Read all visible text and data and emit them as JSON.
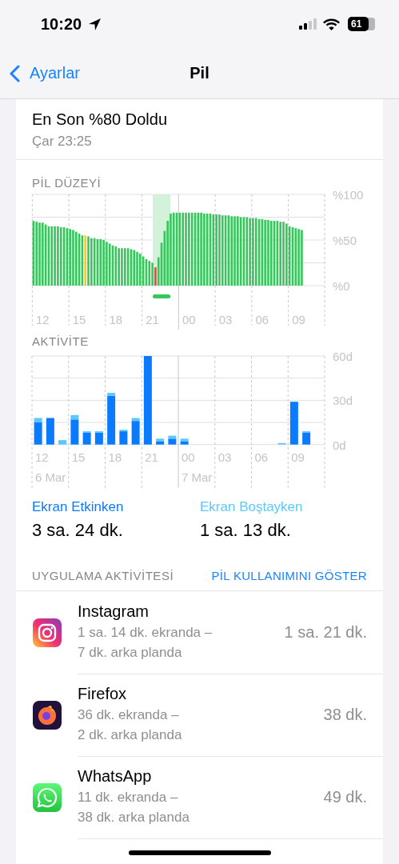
{
  "status_bar": {
    "time": "10:20",
    "battery": "61"
  },
  "nav": {
    "back": "Ayarlar",
    "title": "Pil"
  },
  "last_charge": {
    "title": "En Son %80 Doldu",
    "time": "Çar 23:25"
  },
  "battery_level": {
    "label": "PİL DÜZEYİ",
    "chart_data": {
      "type": "bar",
      "grid": true,
      "ylim": [
        0,
        100
      ],
      "categories": [
        null,
        null,
        null,
        "12",
        null,
        null,
        null,
        null,
        null,
        null,
        null,
        null,
        null,
        null,
        null,
        "15",
        null,
        null,
        null,
        null,
        null,
        null,
        null,
        null,
        null,
        null,
        null,
        "18",
        null,
        null,
        null,
        null,
        null,
        null,
        null,
        null,
        null,
        null,
        null,
        "21",
        null,
        null,
        null,
        null,
        null,
        null,
        null,
        null,
        null,
        null,
        null,
        "00",
        null,
        null,
        null,
        null,
        null,
        null,
        null,
        null,
        null,
        null,
        null,
        "03",
        null,
        null,
        null,
        null,
        null,
        null,
        null,
        null,
        null,
        null,
        null,
        "06",
        null,
        null,
        null,
        null,
        null,
        null,
        null,
        null,
        null,
        null,
        null,
        "09",
        null,
        null,
        null,
        null,
        null,
        null,
        null,
        null
      ],
      "yticks": [
        {
          "value": 0,
          "label": "%0"
        },
        {
          "value": 50,
          "label": "%50"
        },
        {
          "value": 100,
          "label": "%100"
        }
      ],
      "series": [
        {
          "color": "#34c759",
          "values": [
            71,
            70,
            69,
            69,
            67,
            65,
            65,
            65,
            65,
            64,
            64,
            63,
            62,
            61,
            59,
            57,
            55,
            null,
            54,
            52,
            52,
            51,
            51,
            50,
            48,
            46,
            44,
            43,
            41,
            41,
            41,
            41,
            40,
            39,
            37,
            35,
            32,
            29,
            27,
            25,
            null,
            31,
            47,
            60,
            71,
            79,
            80,
            80,
            80,
            80,
            80,
            80,
            80,
            80,
            80,
            80,
            79,
            79,
            79,
            78,
            78,
            78,
            77,
            77,
            77,
            76,
            76,
            76,
            75,
            75,
            75,
            74,
            74,
            74,
            73,
            73,
            72,
            72,
            71,
            71,
            71,
            70,
            70,
            68,
            65,
            64,
            63,
            62,
            61,
            null,
            null,
            null,
            null,
            null,
            null,
            null
          ]
        },
        {
          "color": "#ffcc00",
          "values": [
            null,
            null,
            null,
            null,
            null,
            null,
            null,
            null,
            null,
            null,
            null,
            null,
            null,
            null,
            null,
            null,
            null,
            55,
            null,
            null,
            null,
            null,
            null,
            null,
            null,
            null,
            null,
            null,
            null,
            null,
            null,
            null,
            null,
            null,
            null,
            null,
            null,
            null,
            null,
            null,
            null,
            null,
            null,
            null,
            null,
            null,
            null,
            null,
            null,
            null,
            null,
            null,
            null,
            null,
            null,
            null,
            null,
            null,
            null,
            null,
            null,
            null,
            null,
            null,
            null,
            null,
            null,
            null,
            null,
            null,
            null,
            null,
            null,
            null,
            null,
            null,
            null,
            null,
            null,
            null,
            null,
            null,
            null,
            null,
            null,
            null,
            null,
            null,
            null,
            null,
            null,
            null,
            null,
            null,
            null,
            null
          ]
        },
        {
          "color": "#ff3b30",
          "values": [
            null,
            null,
            null,
            null,
            null,
            null,
            null,
            null,
            null,
            null,
            null,
            null,
            null,
            null,
            null,
            null,
            null,
            null,
            null,
            null,
            null,
            null,
            null,
            null,
            null,
            null,
            null,
            null,
            null,
            null,
            null,
            null,
            null,
            null,
            null,
            null,
            null,
            null,
            null,
            null,
            20,
            null,
            null,
            null,
            null,
            null,
            null,
            null,
            null,
            null,
            null,
            null,
            null,
            null,
            null,
            null,
            null,
            null,
            null,
            null,
            null,
            null,
            null,
            null,
            null,
            null,
            null,
            null,
            null,
            null,
            null,
            null,
            null,
            null,
            null,
            null,
            null,
            null,
            null,
            null,
            null,
            null,
            null,
            null,
            null,
            null,
            null,
            null,
            null,
            null,
            null,
            null,
            null,
            null,
            null,
            null
          ]
        }
      ]
    }
  },
  "activity": {
    "label": "AKTİVİTE",
    "dates": [
      "6 Mar",
      "7 Mar"
    ],
    "chart_data": {
      "type": "bar",
      "stacked": true,
      "grid": true,
      "ylim": [
        0,
        60
      ],
      "categories": [
        "12",
        null,
        null,
        "15",
        null,
        null,
        "18",
        null,
        null,
        "21",
        null,
        null,
        "00",
        null,
        null,
        "03",
        null,
        null,
        "06",
        null,
        null,
        "09",
        null,
        null
      ],
      "yticks": [
        {
          "value": 0,
          "label": "0d"
        },
        {
          "value": 30,
          "label": "30d"
        },
        {
          "value": 60,
          "label": "60d"
        }
      ],
      "series": [
        {
          "name": "Ekran Etkinken",
          "color": "#0a7aff",
          "values": [
            15,
            18,
            0,
            17,
            8,
            8,
            33,
            9,
            16,
            60,
            2,
            4,
            2,
            0,
            0,
            0,
            0,
            0,
            0,
            0,
            0,
            29,
            8,
            null
          ]
        },
        {
          "name": "Ekran Boştayken",
          "color": "#5ac8fa",
          "values": [
            3,
            0,
            3,
            3,
            1,
            1,
            2,
            1,
            2,
            0,
            2,
            2,
            2,
            0,
            0,
            0,
            0,
            0,
            0,
            0,
            1,
            0,
            1,
            null
          ]
        }
      ]
    }
  },
  "summary": [
    {
      "value": "3 sa. 24 dk."
    },
    {
      "value": "1 sa. 13 dk."
    }
  ],
  "app_activity": {
    "header": "UYGULAMA AKTİVİTESİ",
    "action": "PİL KULLANIMINI GÖSTER",
    "apps": [
      {
        "name": "Instagram",
        "kind": "camera",
        "detail": [
          "1 sa. 14 dk. ekranda –",
          "7 dk. arka planda"
        ],
        "total": "1 sa. 21 dk."
      },
      {
        "name": "Firefox",
        "kind": "fox",
        "detail": [
          "36 dk. ekranda –",
          "2 dk. arka planda"
        ],
        "total": "38 dk."
      },
      {
        "name": "WhatsApp",
        "kind": "chat",
        "detail": [
          "11 dk. ekranda –",
          "38 dk. arka planda"
        ],
        "total": "49 dk."
      }
    ]
  }
}
